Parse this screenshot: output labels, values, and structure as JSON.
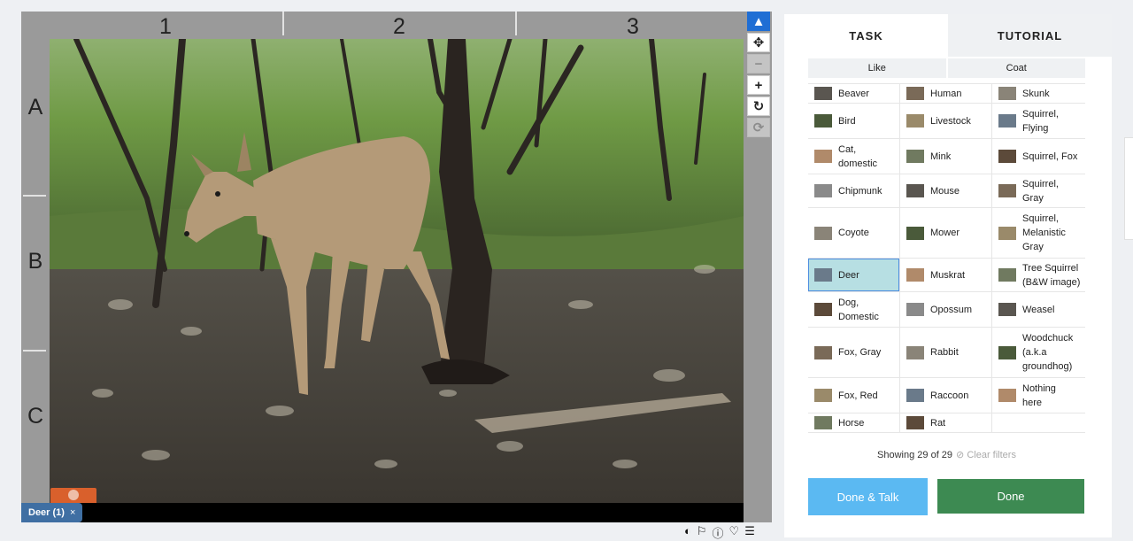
{
  "viewer": {
    "columns": [
      "1",
      "2",
      "3"
    ],
    "rows": [
      "A",
      "B",
      "C"
    ],
    "annotation_chip": {
      "label": "Deer (1)",
      "remove": "×"
    },
    "tools": [
      {
        "name": "pointer-tool",
        "icon": "▲",
        "state": "active"
      },
      {
        "name": "move-tool",
        "icon": "✥",
        "state": "normal"
      },
      {
        "name": "zoom-out-tool",
        "icon": "−",
        "state": "disabled"
      },
      {
        "name": "zoom-in-tool",
        "icon": "+",
        "state": "normal"
      },
      {
        "name": "rotate-tool",
        "icon": "↻",
        "state": "normal"
      },
      {
        "name": "reset-tool",
        "icon": "⟳",
        "state": "disabled"
      }
    ],
    "bottom_icons": [
      "contrast-icon",
      "flag-icon",
      "info-icon",
      "heart-icon",
      "collections-icon"
    ]
  },
  "panel": {
    "tabs": [
      {
        "label": "TASK",
        "active": true
      },
      {
        "label": "TUTORIAL",
        "active": false
      }
    ],
    "filters": [
      "Like",
      "Coat"
    ],
    "species": [
      [
        "Beaver",
        "Human",
        "Skunk"
      ],
      [
        "Bird",
        "Livestock",
        "Squirrel,\nFlying"
      ],
      [
        "Cat,\ndomestic",
        "Mink",
        "Squirrel, Fox"
      ],
      [
        "Chipmunk",
        "Mouse",
        "Squirrel,\nGray"
      ],
      [
        "Coyote",
        "Mower",
        "Squirrel,\nMelanistic\nGray"
      ],
      [
        "Deer",
        "Muskrat",
        "Tree Squirrel\n(B&W image)"
      ],
      [
        "Dog,\nDomestic",
        "Opossum",
        "Weasel"
      ],
      [
        "Fox, Gray",
        "Rabbit",
        "Woodchuck\n(a.k.a\ngroundhog)"
      ],
      [
        "Fox, Red",
        "Raccoon",
        "Nothing\nhere"
      ],
      [
        "Horse",
        "Rat",
        ""
      ]
    ],
    "selected_species": "Deer",
    "showing_text": "Showing 29 of 29",
    "clear_filters": "⊘ Clear filters",
    "done_talk_label": "Done & Talk",
    "done_label": "Done",
    "colors": {
      "done_talk": "#5bb9f2",
      "done": "#3d8a52",
      "selected": "#b7dfe3"
    }
  }
}
